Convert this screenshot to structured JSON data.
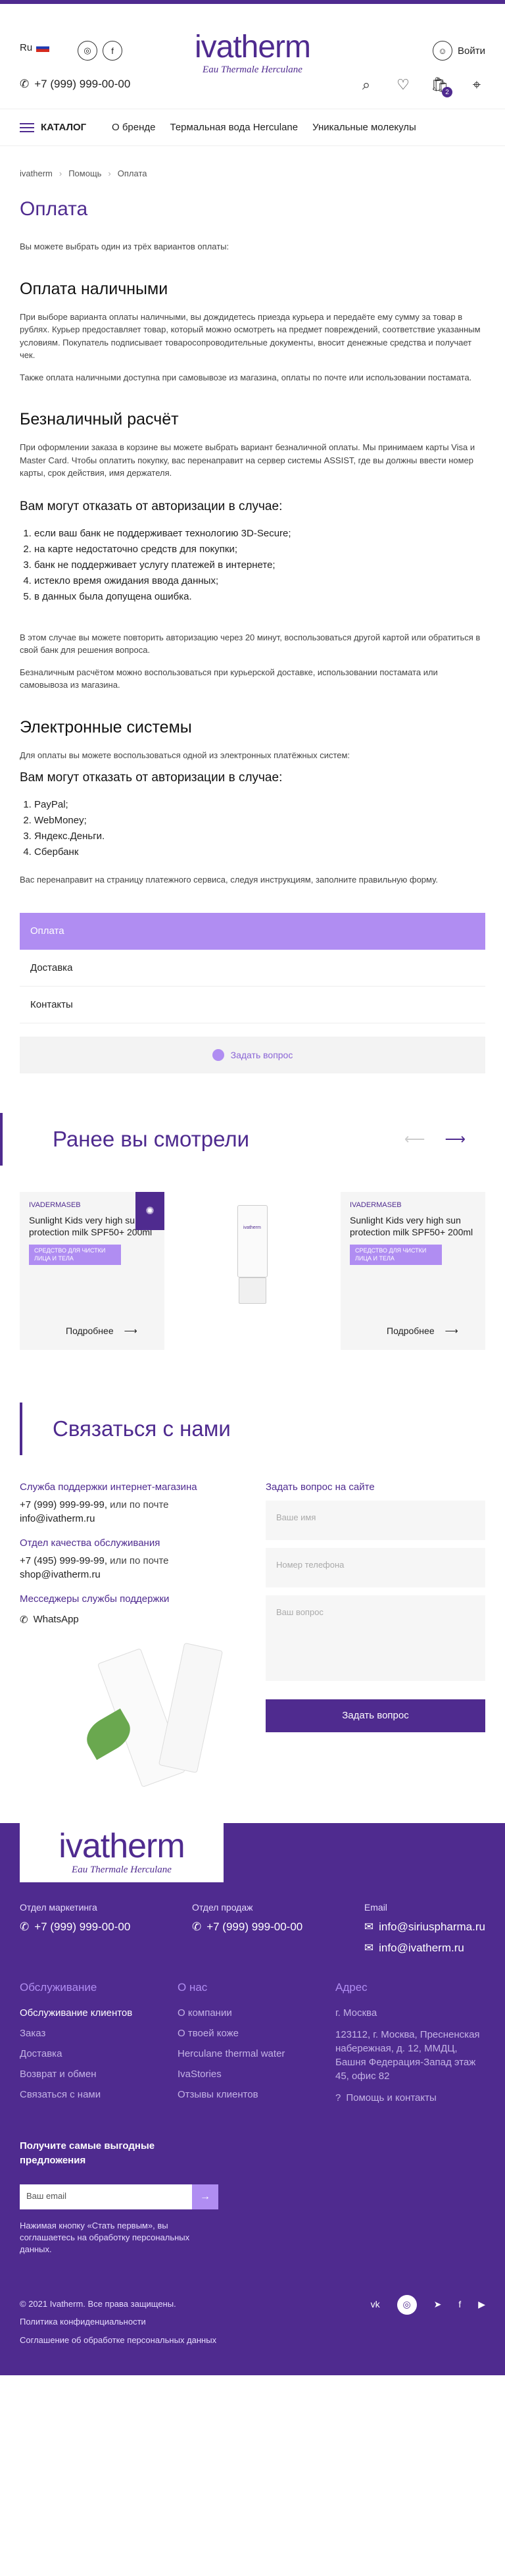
{
  "header": {
    "lang": "Ru",
    "phone": "+7 (999) 999-00-00",
    "logo": {
      "main": "ivatherm",
      "sub": "Eau Thermale Herculane"
    },
    "login_label": "Войти",
    "cart_count": "2"
  },
  "nav": {
    "catalog_label": "КАТАЛОГ",
    "items": [
      "О бренде",
      "Термальная вода Herculane",
      "Уникальные молекулы"
    ]
  },
  "breadcrumbs": [
    "ivatherm",
    "Помощь",
    "Оплата"
  ],
  "page": {
    "title": "Оплата",
    "intro": "Вы можете выбрать один из трёх вариантов оплаты:",
    "cash": {
      "title": "Оплата наличными",
      "p1": "При выборе варианта оплаты наличными, вы дождидетесь приезда курьера и передаёте ему сумму за товар в рублях. Курьер предоставляет товар, который можно осмотреть на предмет повреждений, соответствие указанным условиям. Покупатель подписывает товаросопроводительные документы, вносит денежные средства и получает чек.",
      "p2": "Также оплата наличными доступна при самовывозе из магазина, оплаты по почте или использовании постамата."
    },
    "card": {
      "title": "Безналичный расчёт",
      "p1": "При оформлении заказа в корзине вы можете выбрать вариант безналичной оплаты. Мы принимаем карты Visa и Master Card. Чтобы оплатить покупку, вас перенаправит на сервер системы ASSIST, где вы должны ввести номер карты, срок действия, имя держателя.",
      "refuse_title": "Вам могут отказать от авторизации в случае:",
      "refuse_list": [
        "если ваш банк не поддерживает технологию 3D-Secure;",
        "на карте недостаточно средств для покупки;",
        "банк не поддерживает услугу платежей в интернете;",
        "истекло время ожидания ввода данных;",
        "в данных была допущена ошибка."
      ],
      "p2": "В этом случае вы можете повторить авторизацию через 20 минут, воспользоваться другой картой или обратиться в свой банк для решения вопроса.",
      "p3": "Безналичным расчётом можно воспользоваться при курьерской доставке, использовании постамата или самовывоза из магазина."
    },
    "esys": {
      "title": "Электронные системы",
      "p1": "Для оплаты вы можете воспользоваться одной из электронных платёжных систем:",
      "refuse_title": "Вам могут отказать от авторизации в случае:",
      "list": [
        "PayPal;",
        "WebMoney;",
        "Яндекс.Деньги.",
        "Сбербанк"
      ],
      "p2": "Вас перенаправит на страницу платежного сервиса, следуя инструкциям, заполните правильную форму."
    }
  },
  "accordion": [
    "Оплата",
    "Доставка",
    "Контакты"
  ],
  "ask_label": "Задать вопрос",
  "viewed": {
    "title": "Ранее вы смотрели",
    "products": [
      {
        "brand": "IVADERMASEB",
        "name": "Sunlight Kids very high sun protection milk SPF50+ 200ml",
        "tag": "СРЕДСТВО ДЛЯ ЧИСТКИ ЛИЦА И ТЕЛА",
        "more": "Подробнее"
      },
      {
        "brand": "IVADERMASEB",
        "name": "Sunlight Kids very high sun protection milk SPF50+ 200ml",
        "tag": "СРЕДСТВО ДЛЯ ЧИСТКИ ЛИЦА И ТЕЛА",
        "more": "Подробнее"
      }
    ],
    "bottle_label": "ivatherm"
  },
  "contact": {
    "title": "Связаться с нами",
    "support_label": "Служба поддержки интернет-магазина",
    "support_phone": "+7 (999) 999-99-99,",
    "support_or": " или по почте",
    "support_email": "info@ivatherm.ru",
    "quality_label": "Отдел качества обслуживания",
    "quality_phone": "+7 (495) 999-99-99,",
    "quality_or": " или по почте",
    "quality_email": "shop@ivatherm.ru",
    "messengers_label": "Месседжеры службы поддержки",
    "whatsapp": "WhatsApp",
    "form_title": "Задать вопрос на сайте",
    "name_ph": "Ваше имя",
    "phone_ph": "Номер телефона",
    "question_ph": "Ваш вопрос",
    "submit": "Задать вопрос"
  },
  "footer": {
    "logo": {
      "main": "ivatherm",
      "sub": "Eau Thermale Herculane"
    },
    "marketing_label": "Отдел маркетинга",
    "marketing_phone": "+7 (999) 999-00-00",
    "sales_label": "Отдел продаж",
    "sales_phone": "+7 (999) 999-00-00",
    "email_label": "Email",
    "email1": "info@siriuspharma.ru",
    "email2": "info@ivatherm.ru",
    "service": {
      "head": "Обслуживание",
      "items": [
        "Обслуживание клиентов",
        "Заказ",
        "Доставка",
        "Возврат и обмен",
        "Связаться с нами"
      ]
    },
    "about": {
      "head": "О нас",
      "items": [
        "О компании",
        "О твоей коже",
        "Herculane thermal water",
        "IvaStories",
        "Отзывы клиентов"
      ]
    },
    "address": {
      "head": "Адрес",
      "items": [
        "г. Москва",
        "123112, г. Москва, Пресненская набережная, д. 12, ММДЦ, Башня Федерация-Запад этаж 45, офис 82"
      ],
      "help": "Помощь и контакты"
    },
    "subscribe_title": "Получите самые выгодные предложения",
    "subscribe_ph": "Ваш email",
    "subscribe_note": "Нажимая кнопку «Стать первым», вы соглашаетесь на обработку персональных данных.",
    "copyright": "© 2021 Ivatherm. Все права защищены.",
    "policy": "Политика конфиденциальности",
    "agreement": "Соглашение об обработке персональных данных"
  },
  "colors": {
    "brand": "#4f2b8f",
    "accent": "#b08df2"
  }
}
